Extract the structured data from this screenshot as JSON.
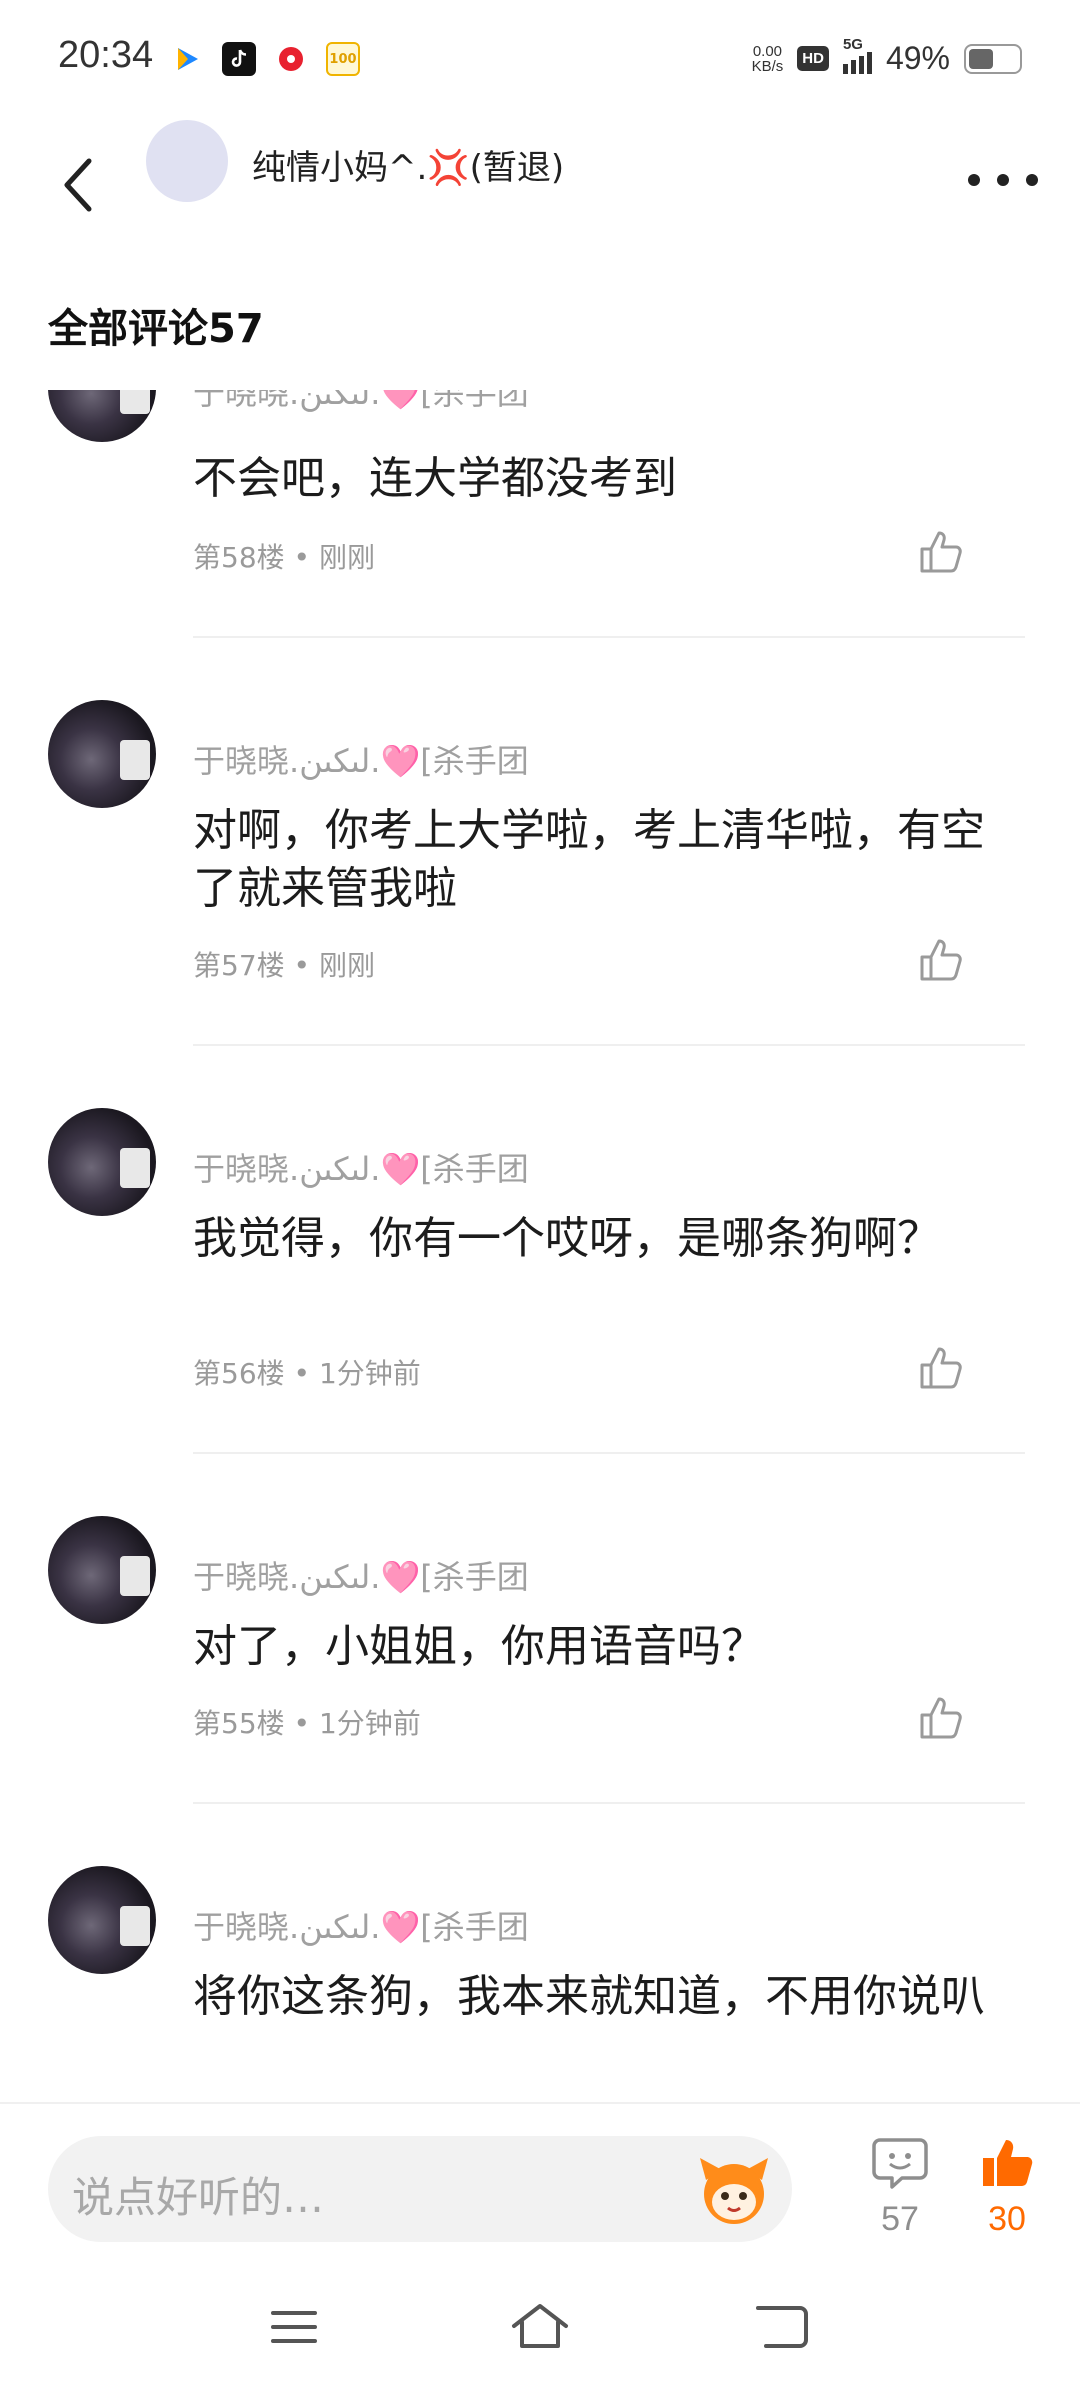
{
  "status_bar": {
    "time": "20:34",
    "net_speed_value": "0.00",
    "net_speed_unit": "KB/s",
    "hd": "HD",
    "network": "5G",
    "battery": "49%",
    "battery_level": 0.49,
    "app_icons": [
      "video-app-icon",
      "tiktok-icon",
      "music-app-icon",
      "app-100-icon"
    ]
  },
  "header": {
    "title": "纯情小妈^.💢(暂退)",
    "avatar_color": "#e0e1f2"
  },
  "section_title": "全部评论57",
  "comments": [
    {
      "user": "于晓晓.لىكىن.🩷[杀手团",
      "text": "不会吧，连大学都没考到",
      "meta": "第58楼 • 刚刚"
    },
    {
      "user": "于晓晓.لىكىن.🩷[杀手团",
      "text": "对啊，你考上大学啦，考上清华啦，有空了就来管我啦",
      "meta": "第57楼 • 刚刚"
    },
    {
      "user": "于晓晓.لىكىن.🩷[杀手团",
      "text": "我觉得，你有一个哎呀，是哪条狗啊？",
      "meta": "第56楼 • 1分钟前"
    },
    {
      "user": "于晓晓.لىكىن.🩷[杀手团",
      "text": "对了，小姐姐，你用语音吗？",
      "meta": "第55楼 • 1分钟前"
    },
    {
      "user": "于晓晓.لىكىن.🩷[杀手团",
      "text": "将你这条狗，我本来就知道，不用你说叭",
      "meta": ""
    }
  ],
  "input_bar": {
    "placeholder": "说点好听的…",
    "comment_count": "57",
    "like_count": "30",
    "accent_color": "#ff6a00"
  }
}
